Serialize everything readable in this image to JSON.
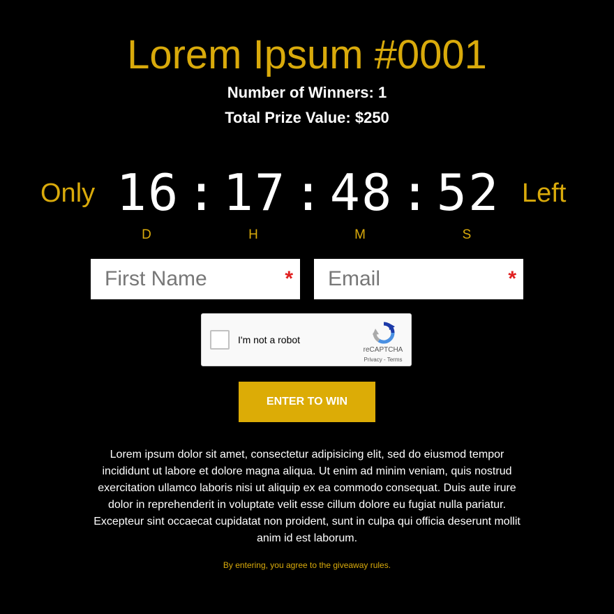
{
  "giveaway": {
    "title": "Lorem Ipsum #0001",
    "winners": "Number of Winners: 1",
    "prize": "Total Prize Value: $250"
  },
  "countdown": {
    "prefix": "Only",
    "suffix": "Left",
    "days": "16",
    "hours": "17",
    "minutes": "48",
    "seconds": "52",
    "separator": ":",
    "unit_days": "D",
    "unit_hours": "H",
    "unit_minutes": "M",
    "unit_seconds": "S"
  },
  "form": {
    "first_name_placeholder": "First Name",
    "email_placeholder": "Email",
    "required_mark": "*",
    "submit_label": "ENTER TO WIN"
  },
  "captcha": {
    "label": "I'm not a robot",
    "brand": "reCAPTCHA",
    "privacy": "Privacy",
    "link_sep": " - ",
    "terms": "Terms",
    "logo_icon": "recaptcha-logo-icon"
  },
  "description": "Lorem ipsum dolor sit amet, consectetur adipisicing elit, sed do eiusmod tempor incididunt ut labore et dolore magna aliqua. Ut enim ad minim veniam, quis nostrud exercitation ullamco laboris nisi ut aliquip ex ea commodo consequat. Duis aute irure dolor in reprehenderit in voluptate velit esse cillum dolore eu fugiat nulla pariatur. Excepteur sint occaecat cupidatat non proident, sunt in culpa qui officia deserunt mollit anim id est laborum.",
  "rules_text": "By entering, you agree to the giveaway rules.",
  "colors": {
    "background": "#000000",
    "accent": "#d9aa0b",
    "button": "#dcac06",
    "required": "#e02020",
    "text": "#ffffff"
  }
}
